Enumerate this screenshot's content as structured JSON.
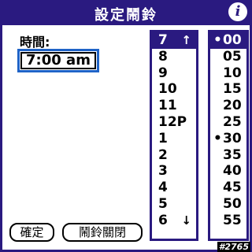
{
  "title_bar": {
    "title": "設定鬧鈴",
    "info_icon": "i"
  },
  "time": {
    "label": "時間:",
    "value": "7:00 am"
  },
  "hours": {
    "items": [
      "7",
      "8",
      "9",
      "10",
      "11",
      "12P",
      "1",
      "2",
      "3",
      "4",
      "5",
      "6"
    ],
    "selected_index": 0,
    "scroll_up_icon": "↑",
    "scroll_down_icon": "↓"
  },
  "minutes": {
    "items": [
      "00",
      "05",
      "10",
      "15",
      "20",
      "25",
      "30",
      "35",
      "40",
      "45",
      "50",
      "55"
    ],
    "selected_index": 0,
    "dot_marker": "•",
    "dotted": [
      0,
      6
    ]
  },
  "buttons": {
    "ok_label": "確定",
    "alarm_off_label": "鬧鈴關閉"
  },
  "corner_tag": "#2765",
  "colors": {
    "accent": "#2a1a80",
    "focus": "#1f63c7"
  }
}
